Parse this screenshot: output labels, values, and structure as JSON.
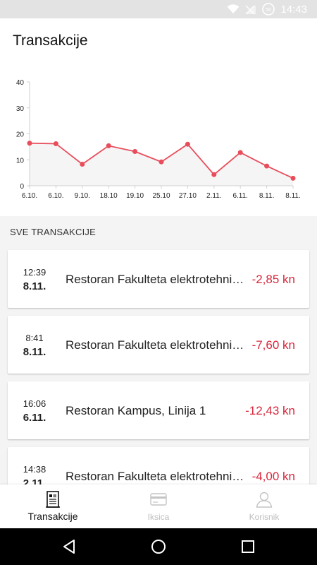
{
  "status_bar": {
    "time": "14:43",
    "battery_level": "56"
  },
  "header": {
    "title": "Transakcije"
  },
  "chart_data": {
    "type": "line",
    "categories": [
      "6.10.",
      "6.10.",
      "9.10.",
      "18.10",
      "19.10",
      "25.10",
      "27.10",
      "2.11.",
      "6.11.",
      "8.11.",
      "8.11."
    ],
    "values": [
      16.4,
      16.2,
      8.3,
      15.4,
      13.2,
      9.2,
      16.0,
      4.3,
      12.8,
      7.6,
      2.9
    ],
    "yticks": [
      0,
      10,
      20,
      30,
      40
    ],
    "ylim": [
      0,
      40
    ],
    "line_color": "#e84d5b",
    "fill_color": "#f5f5f5"
  },
  "section": {
    "label": "SVE TRANSAKCIJE"
  },
  "transactions": [
    {
      "time": "12:39",
      "date": "8.11.",
      "place": "Restoran Fakulteta elektrotehnike i računarstva",
      "amount": "-2,85 kn"
    },
    {
      "time": "8:41",
      "date": "8.11.",
      "place": "Restoran Fakulteta elektrotehnike i računarstva",
      "amount": "-7,60 kn"
    },
    {
      "time": "16:06",
      "date": "6.11.",
      "place": "Restoran Kampus, Linija 1",
      "amount": "-12,43 kn"
    },
    {
      "time": "14:38",
      "date": "2.11.",
      "place": "Restoran Fakulteta elektrotehnike i računarstva",
      "amount": "-4,00 kn"
    }
  ],
  "bottom_nav": {
    "items": [
      {
        "label": "Transakcije",
        "icon": "receipt-icon",
        "active": true
      },
      {
        "label": "Iksica",
        "icon": "card-icon",
        "active": false
      },
      {
        "label": "Korisnik",
        "icon": "user-icon",
        "active": false
      }
    ]
  },
  "colors": {
    "accent": "#d9263a",
    "chart_line": "#e84d5b"
  }
}
